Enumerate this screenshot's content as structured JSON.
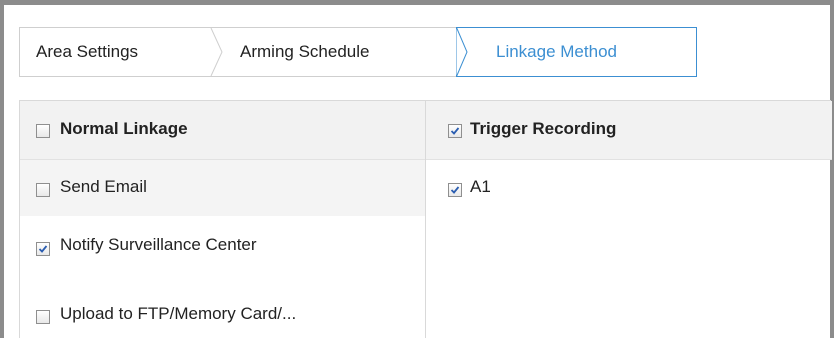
{
  "tabs": [
    {
      "label": "Area Settings",
      "active": false
    },
    {
      "label": "Arming Schedule",
      "active": false
    },
    {
      "label": "Linkage Method",
      "active": true
    }
  ],
  "accent_color": "#3c8fd2",
  "left_column": {
    "header": {
      "label": "Normal Linkage",
      "checked": false
    },
    "items": [
      {
        "label": "Send Email",
        "checked": false
      },
      {
        "label": "Notify Surveillance Center",
        "checked": true
      },
      {
        "label": "Upload to FTP/Memory Card/...",
        "checked": false
      }
    ]
  },
  "right_column": {
    "header": {
      "label": "Trigger Recording",
      "checked": true
    },
    "items": [
      {
        "label": "A1",
        "checked": true
      }
    ]
  }
}
